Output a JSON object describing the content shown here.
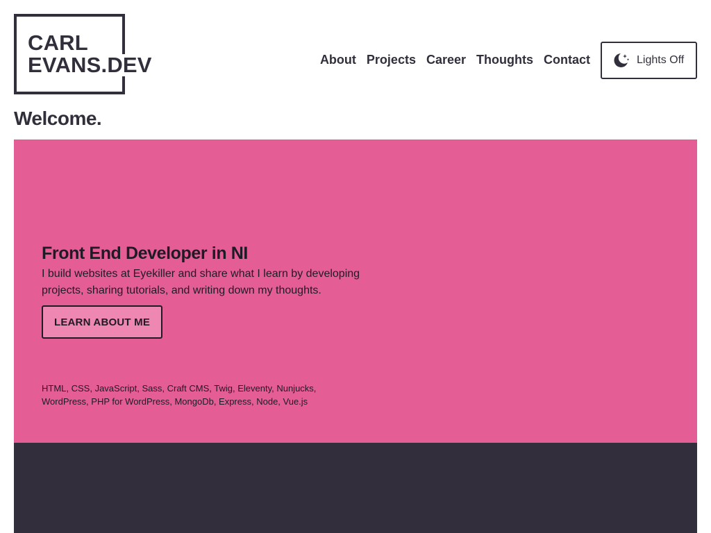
{
  "header": {
    "logo_line1": "CARL",
    "logo_line2": "EVANS.DEV",
    "nav": [
      {
        "label": "About"
      },
      {
        "label": "Projects"
      },
      {
        "label": "Career"
      },
      {
        "label": "Thoughts"
      },
      {
        "label": "Contact"
      }
    ],
    "lights_button": {
      "label": "Lights Off",
      "icon": "moon-stars-icon"
    }
  },
  "page": {
    "welcome": "Welcome."
  },
  "hero": {
    "heading": "Front End Developer in NI",
    "intro": "I build websites at Eyekiller and share what I learn by developing projects, sharing tutorials, and writing down my thoughts.",
    "cta_label": "LEARN ABOUT ME",
    "tech_list": "HTML, CSS, JavaScript, Sass, Craft CMS, Twig, Eleventy, Nunjucks, WordPress, PHP for WordPress, MongoDb, Express, Node, Vue.js"
  },
  "colors": {
    "hero_bg": "#e45d95",
    "button_bg": "#ee88b2",
    "dark": "#332e3b",
    "text": "#1f1b24"
  }
}
